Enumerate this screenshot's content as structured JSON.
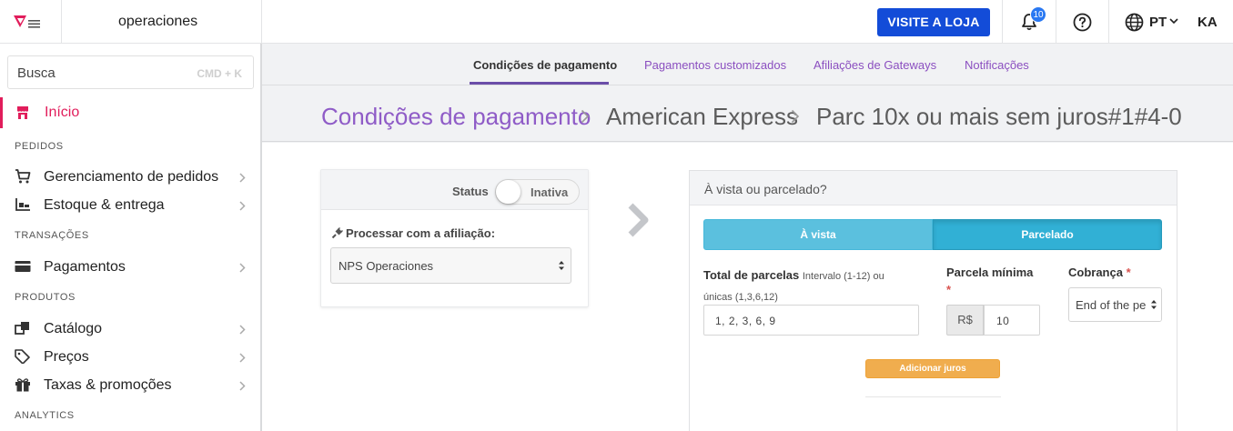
{
  "topbar": {
    "logo_icon": "vtex-logo-icon",
    "account_name": "operaciones",
    "visit_store_label": "VISITE A LOJA",
    "notifications_icon": "bell-icon",
    "notifications_count": "10",
    "help_icon": "question-circle-icon",
    "language_icon": "globe-icon",
    "language_code": "PT",
    "user_initials": "KA"
  },
  "sidebar": {
    "search_placeholder": "Busca",
    "search_shortcut": "CMD + K",
    "home_label": "Início",
    "sections": {
      "pedidos": "PEDIDOS",
      "transacoes": "TRANSAÇÕES",
      "produtos": "PRODUTOS",
      "analytics": "ANALYTICS"
    },
    "items": {
      "orders": "Gerenciamento de pedidos",
      "inventory": "Estoque & entrega",
      "payments": "Pagamentos",
      "catalog": "Catálogo",
      "prices": "Preços",
      "promotions": "Taxas & promoções"
    },
    "active_color": "#e11d5b"
  },
  "tabs": [
    {
      "label": "Condições de pagamento",
      "active": true
    },
    {
      "label": "Pagamentos customizados",
      "active": false
    },
    {
      "label": "Afiliações de Gateways",
      "active": false
    },
    {
      "label": "Notificações",
      "active": false
    }
  ],
  "breadcrumb": {
    "root": "Condições de pagamento",
    "method": "American Express",
    "rule": "Parc 10x ou mais sem juros#1#4-0"
  },
  "status_card": {
    "status_label": "Status",
    "status_value": "Inativa",
    "affiliation_label": "Processar com a afiliação:",
    "affiliation_value": "NPS Operaciones"
  },
  "installments_card": {
    "title": "À vista ou parcelado?",
    "option_cash": "À vista",
    "option_installments": "Parcelado",
    "selected_option": "Parcelado",
    "total_label": "Total de parcelas",
    "total_hint": "Intervalo (1-12) ou únicas (1,3,6,12)",
    "total_value": "1, 2, 3, 6, 9",
    "min_label": "Parcela mínima",
    "currency": "R$",
    "min_value": "10",
    "charge_label": "Cobrança",
    "charge_value": "End of the period",
    "add_interest_label": "Adicionar juros"
  },
  "colors": {
    "primary_blue": "#134cd8",
    "purple_link": "#8b4fc0",
    "info_light": "#5bc0de",
    "info_dark": "#31b0d5",
    "warning": "#f0ad4e"
  }
}
